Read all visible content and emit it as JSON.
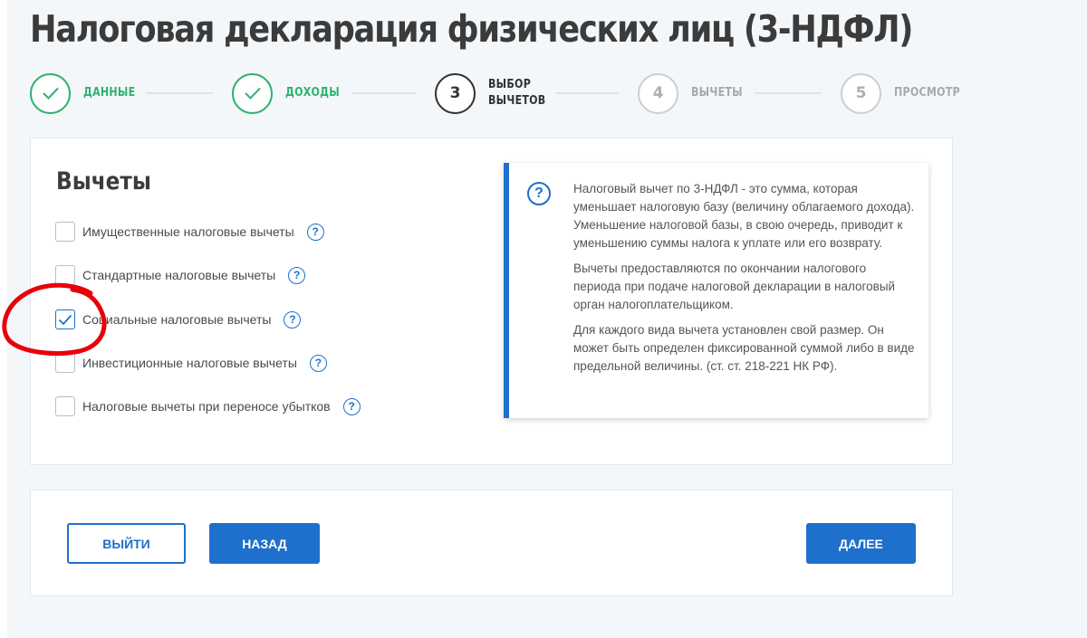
{
  "page_title": "Налоговая декларация физических лиц (3-НДФЛ)",
  "steps": [
    {
      "number": "1",
      "label_lines": [
        "ДАННЫЕ"
      ],
      "state": "done"
    },
    {
      "number": "2",
      "label_lines": [
        "ДОХОДЫ"
      ],
      "state": "done"
    },
    {
      "number": "3",
      "label_lines": [
        "ВЫБОР",
        "ВЫЧЕТОВ"
      ],
      "state": "active"
    },
    {
      "number": "4",
      "label_lines": [
        "ВЫЧЕТЫ"
      ],
      "state": "pending"
    },
    {
      "number": "5",
      "label_lines": [
        "ПРОСМОТР"
      ],
      "state": "pending"
    }
  ],
  "deductions": {
    "title": "Вычеты",
    "options": [
      {
        "label": "Имущественные налоговые вычеты",
        "checked": false
      },
      {
        "label": "Стандартные налоговые вычеты",
        "checked": false
      },
      {
        "label": "Социальные налоговые вычеты",
        "checked": true
      },
      {
        "label": "Инвестиционные налоговые вычеты",
        "checked": false
      },
      {
        "label": "Налоговые вычеты при переносе убытков",
        "checked": false
      }
    ],
    "help_glyph": "?"
  },
  "info": {
    "icon": "question-circle-icon",
    "paragraphs": [
      "Налоговый вычет по 3-НДФЛ - это сумма, которая уменьшает налоговую базу (величину облагаемого дохода). Уменьшение налоговой базы, в свою очередь, приводит к уменьшению суммы налога к уплате или его возврату.",
      "Вычеты предоставляются по окончании налогового периода при подаче налоговой декларации в налоговый орган налогоплательщиком.",
      "Для каждого вида вычета установлен свой размер. Он может быть определен фиксированной суммой либо в виде предельной величины. (ст. ст. 218-221 НК РФ)."
    ]
  },
  "buttons": {
    "exit": "ВЫЙТИ",
    "back": "НАЗАД",
    "next": "ДАЛЕЕ"
  },
  "colors": {
    "accent": "#1f6fcc",
    "done": "#2db36f",
    "annotation": "#e8000b"
  }
}
